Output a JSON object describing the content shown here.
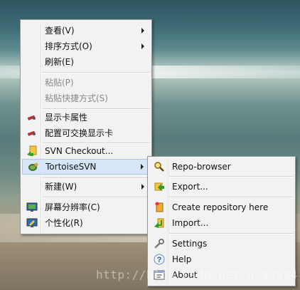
{
  "main_menu": {
    "items": [
      {
        "label": "查看(V)",
        "submenu": true
      },
      {
        "label": "排序方式(O)",
        "submenu": true
      },
      {
        "label": "刷新(E)"
      },
      {
        "label": "粘贴(P)",
        "disabled": true
      },
      {
        "label": "粘贴快捷方式(S)",
        "disabled": true
      },
      {
        "label": "显示卡属性",
        "icon": "display-card-icon"
      },
      {
        "label": "配置可交换显示卡",
        "icon": "display-card-icon"
      },
      {
        "label": "SVN Checkout...",
        "icon": "svn-checkout-icon"
      },
      {
        "label": "TortoiseSVN",
        "icon": "tortoisesvn-icon",
        "submenu": true,
        "highlighted": true
      },
      {
        "label": "新建(W)",
        "submenu": true
      },
      {
        "label": "屏幕分辨率(C)",
        "icon": "screen-resolution-icon"
      },
      {
        "label": "个性化(R)",
        "icon": "personalize-icon"
      }
    ]
  },
  "svn_submenu": {
    "items": [
      {
        "label": "Repo-browser",
        "icon": "repo-browser-icon"
      },
      {
        "label": "Export...",
        "icon": "export-icon"
      },
      {
        "label": "Create repository here",
        "icon": "create-repository-icon"
      },
      {
        "label": "Import...",
        "icon": "import-icon"
      },
      {
        "label": "Settings",
        "icon": "settings-icon"
      },
      {
        "label": "Help",
        "icon": "help-icon"
      },
      {
        "label": "About",
        "icon": "about-icon"
      }
    ]
  },
  "watermark": "http://blog.csdn.net/q290994"
}
